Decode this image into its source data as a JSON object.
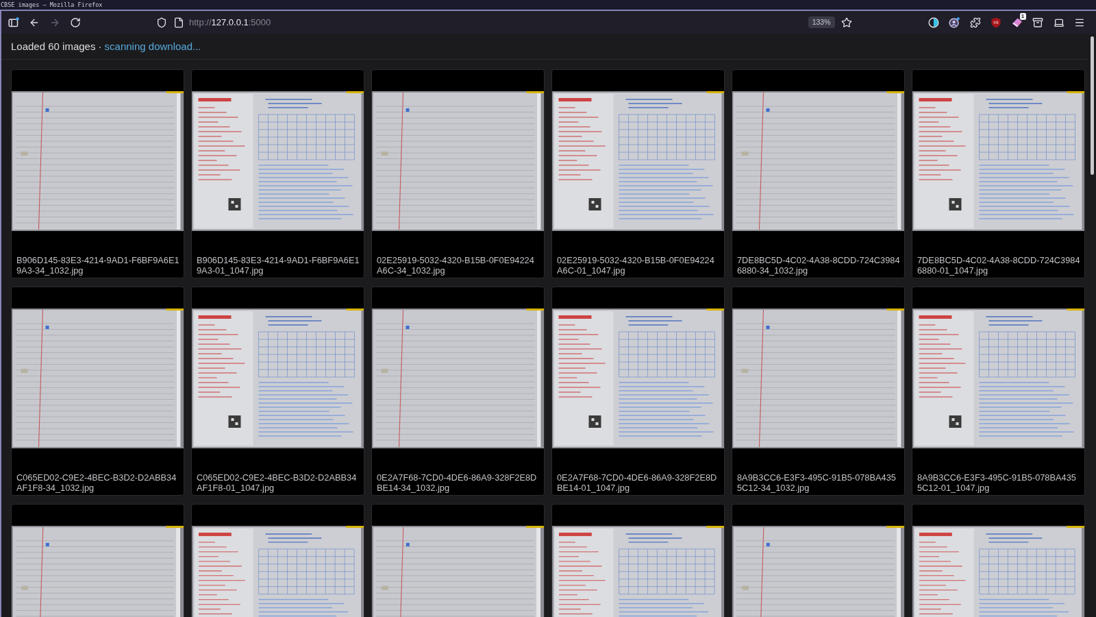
{
  "window": {
    "title": "CBSE images — Mozilla Firefox"
  },
  "toolbar": {
    "nav_buttons": [
      {
        "kind": "sidebar",
        "disabled": false
      },
      {
        "kind": "back",
        "disabled": false
      },
      {
        "kind": "forward",
        "disabled": true
      },
      {
        "kind": "reload",
        "disabled": false
      }
    ],
    "address": {
      "scheme": "http://",
      "host": "127.0.0.1",
      "port": ":5000"
    },
    "zoom": "133%",
    "icons": [
      {
        "kind": "contrast"
      },
      {
        "kind": "account"
      },
      {
        "kind": "extensions"
      },
      {
        "kind": "blocker"
      },
      {
        "kind": "eraser",
        "badge": "1"
      },
      {
        "kind": "tray"
      },
      {
        "kind": "laptop"
      },
      {
        "kind": "menu"
      }
    ]
  },
  "status_bar": {
    "summary": "Loaded 60 images ·",
    "progress": "scanning download..."
  },
  "images": [
    {
      "kind": "ruled",
      "filename": "B906D145-83E3-4214-9AD1-F6BF9A6E19A3-34_1032.jpg"
    },
    {
      "kind": "form",
      "filename": "B906D145-83E3-4214-9AD1-F6BF9A6E19A3-01_1047.jpg"
    },
    {
      "kind": "ruled",
      "filename": "02E25919-5032-4320-B15B-0F0E94224A6C-34_1032.jpg"
    },
    {
      "kind": "form",
      "filename": "02E25919-5032-4320-B15B-0F0E94224A6C-01_1047.jpg"
    },
    {
      "kind": "ruled",
      "filename": "7DE8BC5D-4C02-4A38-8CDD-724C39846880-34_1032.jpg"
    },
    {
      "kind": "form",
      "filename": "7DE8BC5D-4C02-4A38-8CDD-724C39846880-01_1047.jpg"
    },
    {
      "kind": "ruled",
      "filename": "C065ED02-C9E2-4BEC-B3D2-D2ABB34AF1F8-34_1032.jpg"
    },
    {
      "kind": "form",
      "filename": "C065ED02-C9E2-4BEC-B3D2-D2ABB34AF1F8-01_1047.jpg"
    },
    {
      "kind": "ruled",
      "filename": "0E2A7F68-7CD0-4DE6-86A9-328F2E8DBE14-34_1032.jpg"
    },
    {
      "kind": "form",
      "filename": "0E2A7F68-7CD0-4DE6-86A9-328F2E8DBE14-01_1047.jpg"
    },
    {
      "kind": "ruled",
      "filename": "8A9B3CC6-E3F3-495C-91B5-078BA4355C12-34_1032.jpg"
    },
    {
      "kind": "form",
      "filename": "8A9B3CC6-E3F3-495C-91B5-078BA4355C12-01_1047.jpg"
    },
    {
      "kind": "ruled"
    },
    {
      "kind": "form"
    },
    {
      "kind": "ruled"
    },
    {
      "kind": "form"
    },
    {
      "kind": "ruled"
    },
    {
      "kind": "form"
    }
  ]
}
